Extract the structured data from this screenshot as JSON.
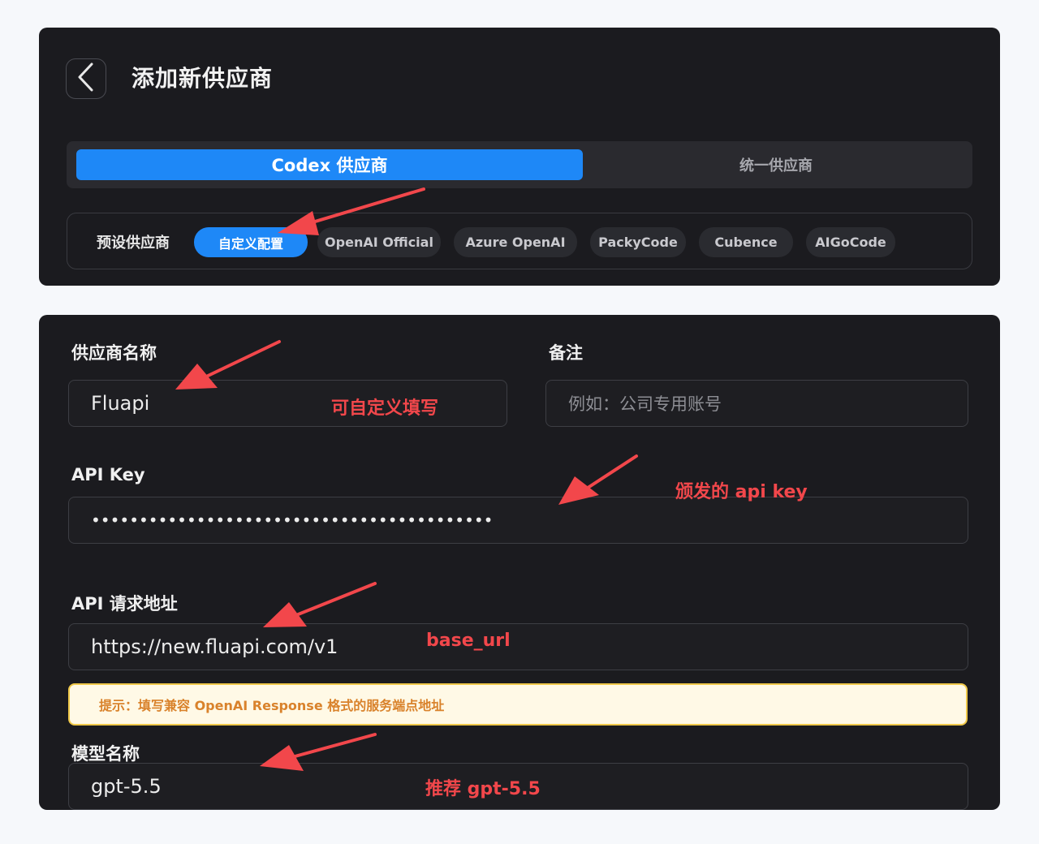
{
  "header": {
    "title": "添加新供应商"
  },
  "mode_tabs": [
    {
      "label": "Codex 供应商",
      "active": true
    },
    {
      "label": "统一供应商",
      "active": false
    }
  ],
  "presets": {
    "label": "预设供应商",
    "items": [
      {
        "label": "自定义配置",
        "active": true
      },
      {
        "label": "OpenAI Official",
        "active": false
      },
      {
        "label": "Azure OpenAI",
        "active": false
      },
      {
        "label": "PackyCode",
        "active": false
      },
      {
        "label": "Cubence",
        "active": false
      },
      {
        "label": "AIGoCode",
        "active": false
      }
    ]
  },
  "form": {
    "name_label": "供应商名称",
    "name_value": "Fluapi",
    "note_label": "备注",
    "note_placeholder": "例如：公司专用账号",
    "api_key_label": "API Key",
    "api_key_value": "••••••••••••••••••••••••••••••••••••••••••",
    "url_label": "API 请求地址",
    "url_value": "https://new.fluapi.com/v1",
    "tip": "提示：填写兼容 OpenAI Response 格式的服务端点地址",
    "model_label": "模型名称",
    "model_value": "gpt-5.5"
  },
  "annotations": {
    "name": "可自定义填写",
    "api_key": "颁发的 api key",
    "url": "base_url",
    "model": "推荐 gpt-5.5"
  },
  "colors": {
    "accent": "#1e88f7",
    "annotation": "#f2474b",
    "panel": "#1b1b1f",
    "tip_background": "#fff9e6",
    "tip_text": "#d9822b"
  }
}
